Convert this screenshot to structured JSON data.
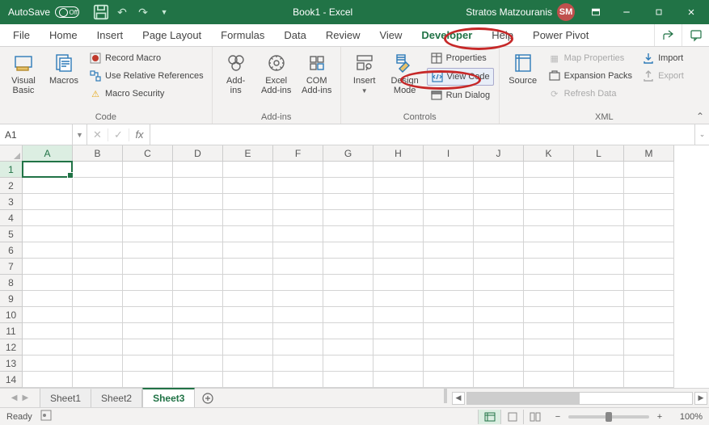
{
  "titlebar": {
    "autosave_label": "AutoSave",
    "autosave_state": "Off",
    "doc_title": "Book1 - Excel",
    "user_name": "Stratos Matzouranis",
    "user_initials": "SM"
  },
  "tabs": {
    "file": "File",
    "items": [
      "Home",
      "Insert",
      "Page Layout",
      "Formulas",
      "Data",
      "Review",
      "View",
      "Developer",
      "Help",
      "Power Pivot"
    ],
    "active": "Developer"
  },
  "ribbon": {
    "code": {
      "visual_basic": "Visual\nBasic",
      "macros": "Macros",
      "record_macro": "Record Macro",
      "use_relative": "Use Relative References",
      "macro_security": "Macro Security",
      "group_label": "Code"
    },
    "addins": {
      "addins": "Add-\nins",
      "excel_addins": "Excel\nAdd-ins",
      "com_addins": "COM\nAdd-ins",
      "group_label": "Add-ins"
    },
    "controls": {
      "insert": "Insert",
      "design_mode": "Design\nMode",
      "properties": "Properties",
      "view_code": "View Code",
      "run_dialog": "Run Dialog",
      "group_label": "Controls"
    },
    "xml": {
      "source": "Source",
      "map_properties": "Map Properties",
      "expansion_packs": "Expansion Packs",
      "refresh_data": "Refresh Data",
      "import": "Import",
      "export": "Export",
      "group_label": "XML"
    }
  },
  "formula_bar": {
    "name_box": "A1",
    "fx_label": "fx",
    "formula": ""
  },
  "grid": {
    "columns": [
      "A",
      "B",
      "C",
      "D",
      "E",
      "F",
      "G",
      "H",
      "I",
      "J",
      "K",
      "L",
      "M"
    ],
    "rows": [
      "1",
      "2",
      "3",
      "4",
      "5",
      "6",
      "7",
      "8",
      "9",
      "10",
      "11",
      "12",
      "13",
      "14"
    ],
    "active_col": "A",
    "active_row": "1"
  },
  "sheets": {
    "items": [
      "Sheet1",
      "Sheet2",
      "Sheet3"
    ],
    "active": "Sheet3"
  },
  "statusbar": {
    "ready": "Ready",
    "zoom": "100%"
  }
}
